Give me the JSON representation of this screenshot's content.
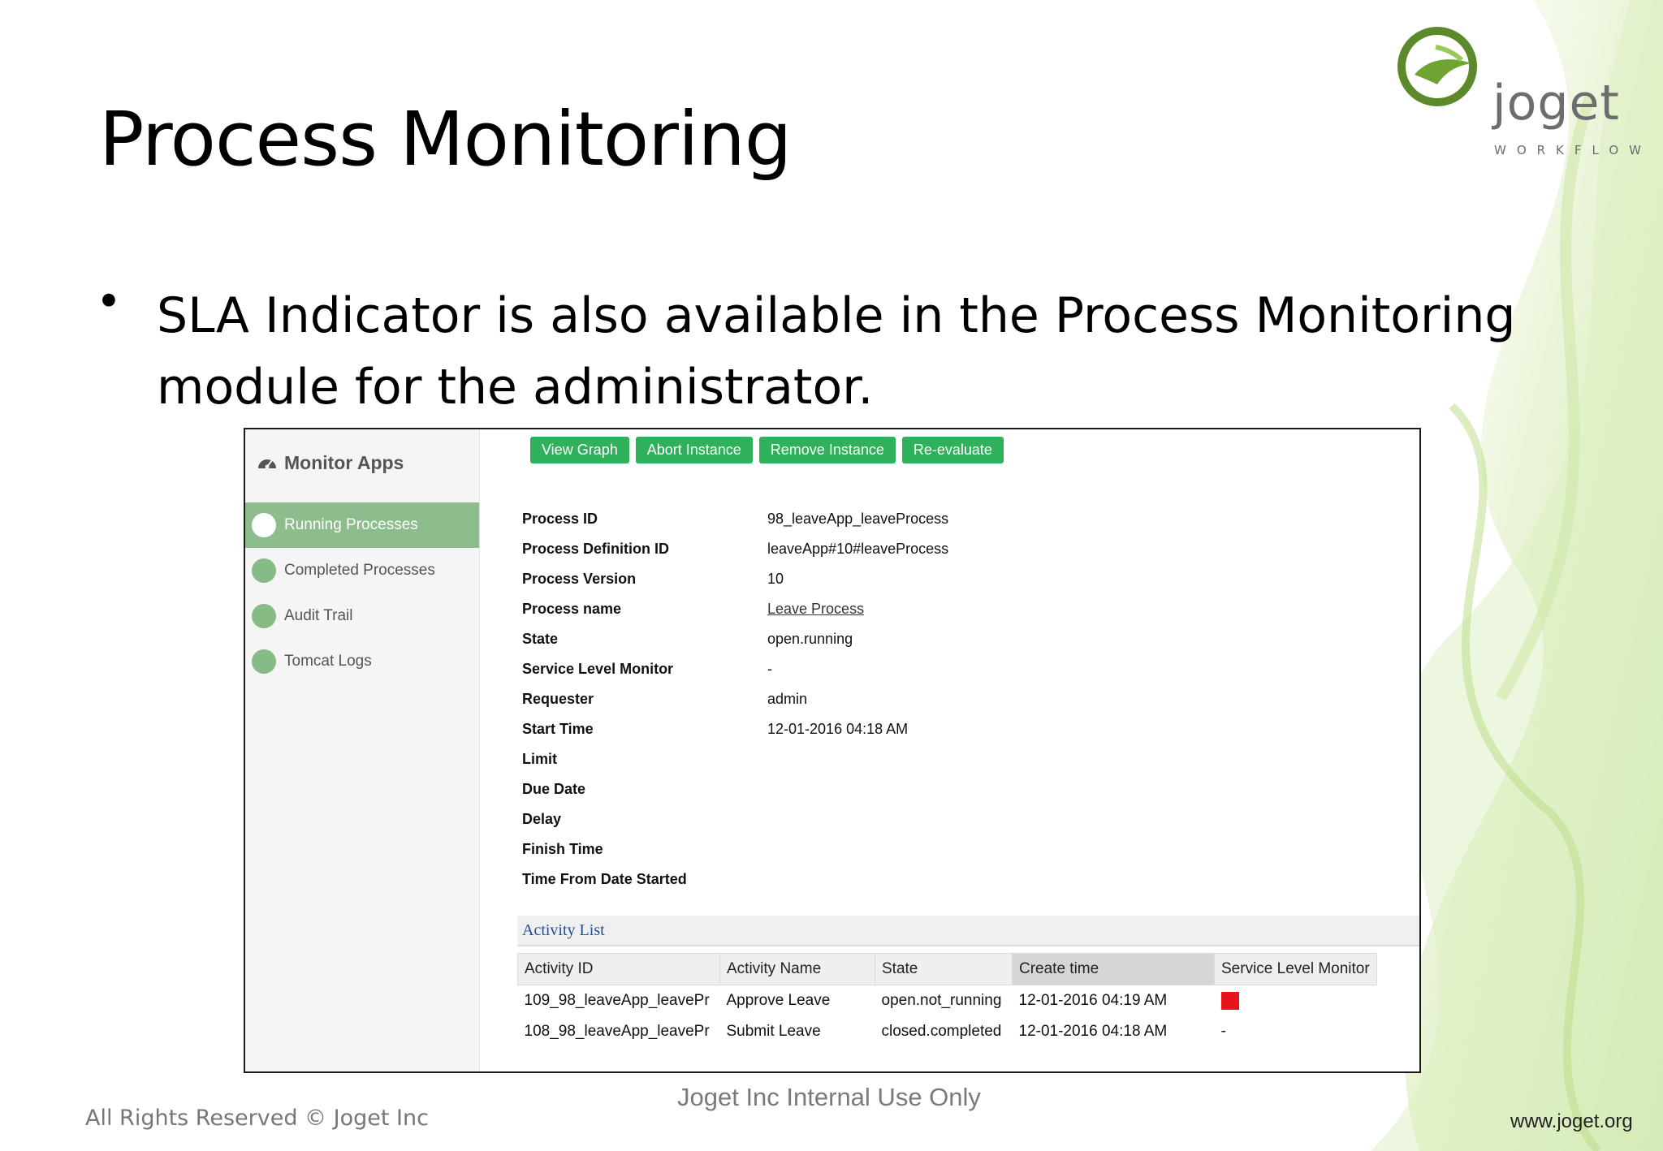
{
  "slide": {
    "title": "Process Monitoring",
    "bullet": "SLA Indicator is also available in the Process Monitoring module for the administrator.",
    "footer_left": "All Rights Reserved © Joget Inc",
    "footer_center": "Joget Inc Internal Use Only",
    "footer_right": "www.joget.org"
  },
  "logo": {
    "word": "joget",
    "sub": "WORKFLOW"
  },
  "sidebar": {
    "title": "Monitor Apps",
    "items": [
      {
        "label": "Running Processes",
        "active": true
      },
      {
        "label": "Completed Processes",
        "active": false
      },
      {
        "label": "Audit Trail",
        "active": false
      },
      {
        "label": "Tomcat Logs",
        "active": false
      }
    ]
  },
  "toolbar": {
    "view_graph": "View Graph",
    "abort_instance": "Abort Instance",
    "remove_instance": "Remove Instance",
    "re_evaluate": "Re-evaluate"
  },
  "details": [
    {
      "label": "Process ID",
      "value": "98_leaveApp_leaveProcess"
    },
    {
      "label": "Process Definition ID",
      "value": "leaveApp#10#leaveProcess"
    },
    {
      "label": "Process Version",
      "value": "10"
    },
    {
      "label": "Process name",
      "value": "Leave Process"
    },
    {
      "label": "State",
      "value": "open.running"
    },
    {
      "label": "Service Level Monitor",
      "value": "-"
    },
    {
      "label": "Requester",
      "value": "admin"
    },
    {
      "label": "Start Time",
      "value": "12-01-2016 04:18 AM"
    },
    {
      "label": "Limit",
      "value": ""
    },
    {
      "label": "Due Date",
      "value": ""
    },
    {
      "label": "Delay",
      "value": ""
    },
    {
      "label": "Finish Time",
      "value": ""
    },
    {
      "label": "Time From Date Started",
      "value": ""
    }
  ],
  "activity_list": {
    "title": "Activity List",
    "columns": [
      "Activity ID",
      "Activity Name",
      "State",
      "Create time",
      "Service Level Monitor"
    ],
    "rows": [
      {
        "id": "109_98_leaveApp_leavePr",
        "name": "Approve Leave",
        "state": "open.not_running",
        "create_time": "12-01-2016 04:19 AM",
        "sla": "red"
      },
      {
        "id": "108_98_leaveApp_leavePr",
        "name": "Submit Leave",
        "state": "closed.completed",
        "create_time": "12-01-2016 04:18 AM",
        "sla": "-"
      }
    ],
    "sla_color": "#e8141a"
  },
  "colors": {
    "button": "#2fb15c",
    "sidebar_active": "#8dbc8d",
    "sidebar_dot": "#86bb86"
  }
}
